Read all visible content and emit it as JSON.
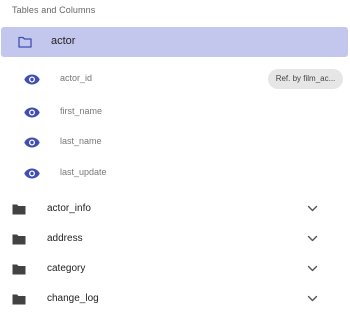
{
  "section_title": "Tables and Columns",
  "selected_table": {
    "name": "actor",
    "icon": "folder-outline-icon"
  },
  "columns": [
    {
      "name": "actor_id",
      "icon": "eye-icon"
    },
    {
      "name": "first_name",
      "icon": "eye-icon"
    },
    {
      "name": "last_name",
      "icon": "eye-icon"
    },
    {
      "name": "last_update",
      "icon": "eye-icon"
    }
  ],
  "reference_chip": "Ref. by film_ac...",
  "tables": [
    {
      "name": "actor_info",
      "icon": "folder-icon",
      "toggle": "chevron-down-icon"
    },
    {
      "name": "address",
      "icon": "folder-icon",
      "toggle": "chevron-down-icon"
    },
    {
      "name": "category",
      "icon": "folder-icon",
      "toggle": "chevron-down-icon"
    },
    {
      "name": "change_log",
      "icon": "folder-icon",
      "toggle": "chevron-down-icon"
    }
  ],
  "colors": {
    "selected_bg": "#c3c7ee",
    "accent": "#3f4fb5",
    "folder": "#424242"
  }
}
